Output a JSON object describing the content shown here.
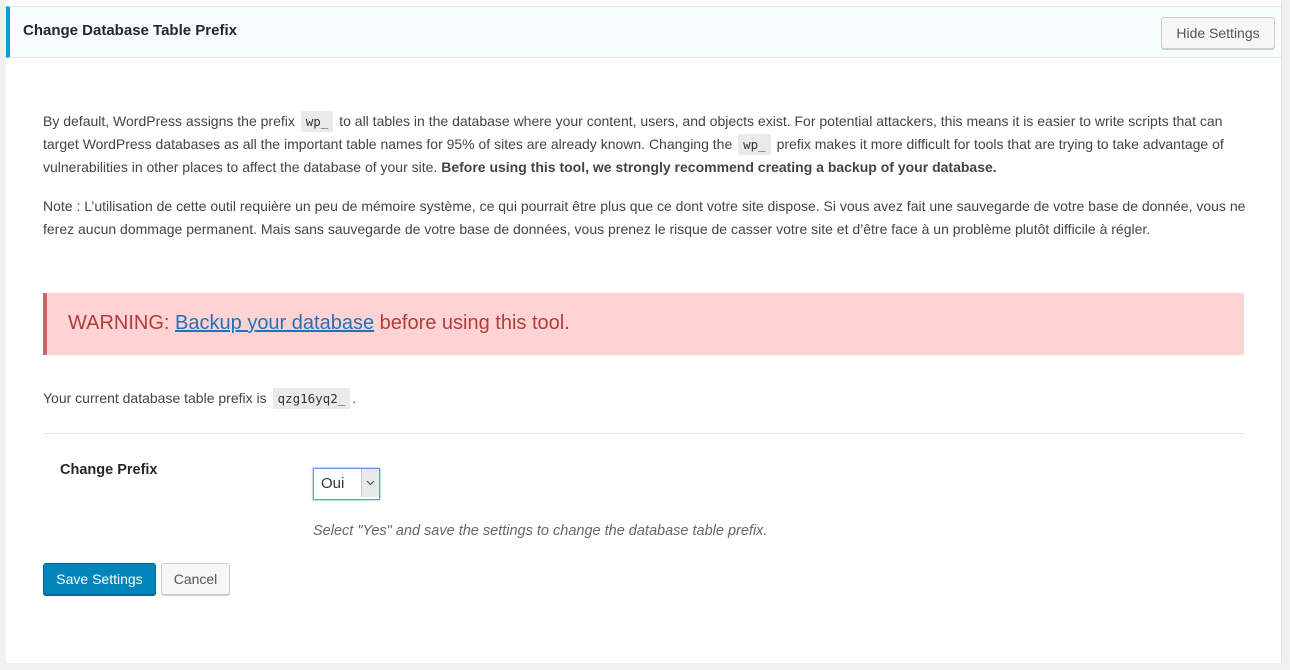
{
  "header": {
    "title": "Change Database Table Prefix",
    "hide_settings_label": "Hide Settings"
  },
  "intro": {
    "part1": "By default, WordPress assigns the prefix",
    "code1": "wp_",
    "part2": "to all tables in the database where your content, users, and objects exist. For potential attackers, this means it is easier to write scripts that can target WordPress databases as all the important table names for 95% of sites are already known. Changing the",
    "code2": "wp_",
    "part3": "prefix makes it more difficult for tools that are trying to take advantage of vulnerabilities in other places to affect the database of your site.",
    "bold": "Before using this tool, we strongly recommend creating a backup of your database."
  },
  "note": "Note : L’utilisation de cette outil requière un peu de mémoire système, ce qui pourrait être plus que ce dont votre site dispose. Si vous avez fait une sauvegarde de votre base de donnée, vous ne ferez aucun dommage permanent. Mais sans sauvegarde de votre base de données, vous prenez le risque de casser votre site et d’être face à un problème plutôt difficile à régler.",
  "warning": {
    "prefix": "WARNING:",
    "link": "Backup your database",
    "suffix": "before using this tool."
  },
  "current_prefix": {
    "label": "Your current database table prefix is",
    "value": "qzg16yq2_",
    "end": "."
  },
  "form": {
    "label": "Change Prefix",
    "select_value": "Oui",
    "description": "Select \"Yes\" and save the settings to change the database table prefix."
  },
  "buttons": {
    "save": "Save Settings",
    "cancel": "Cancel"
  },
  "colors": {
    "accent": "#00a0d2",
    "primary_button": "#0085ba",
    "warning_bg": "#ffd3d3",
    "warning_text": "#b13d3d",
    "link": "#1f72b8"
  }
}
